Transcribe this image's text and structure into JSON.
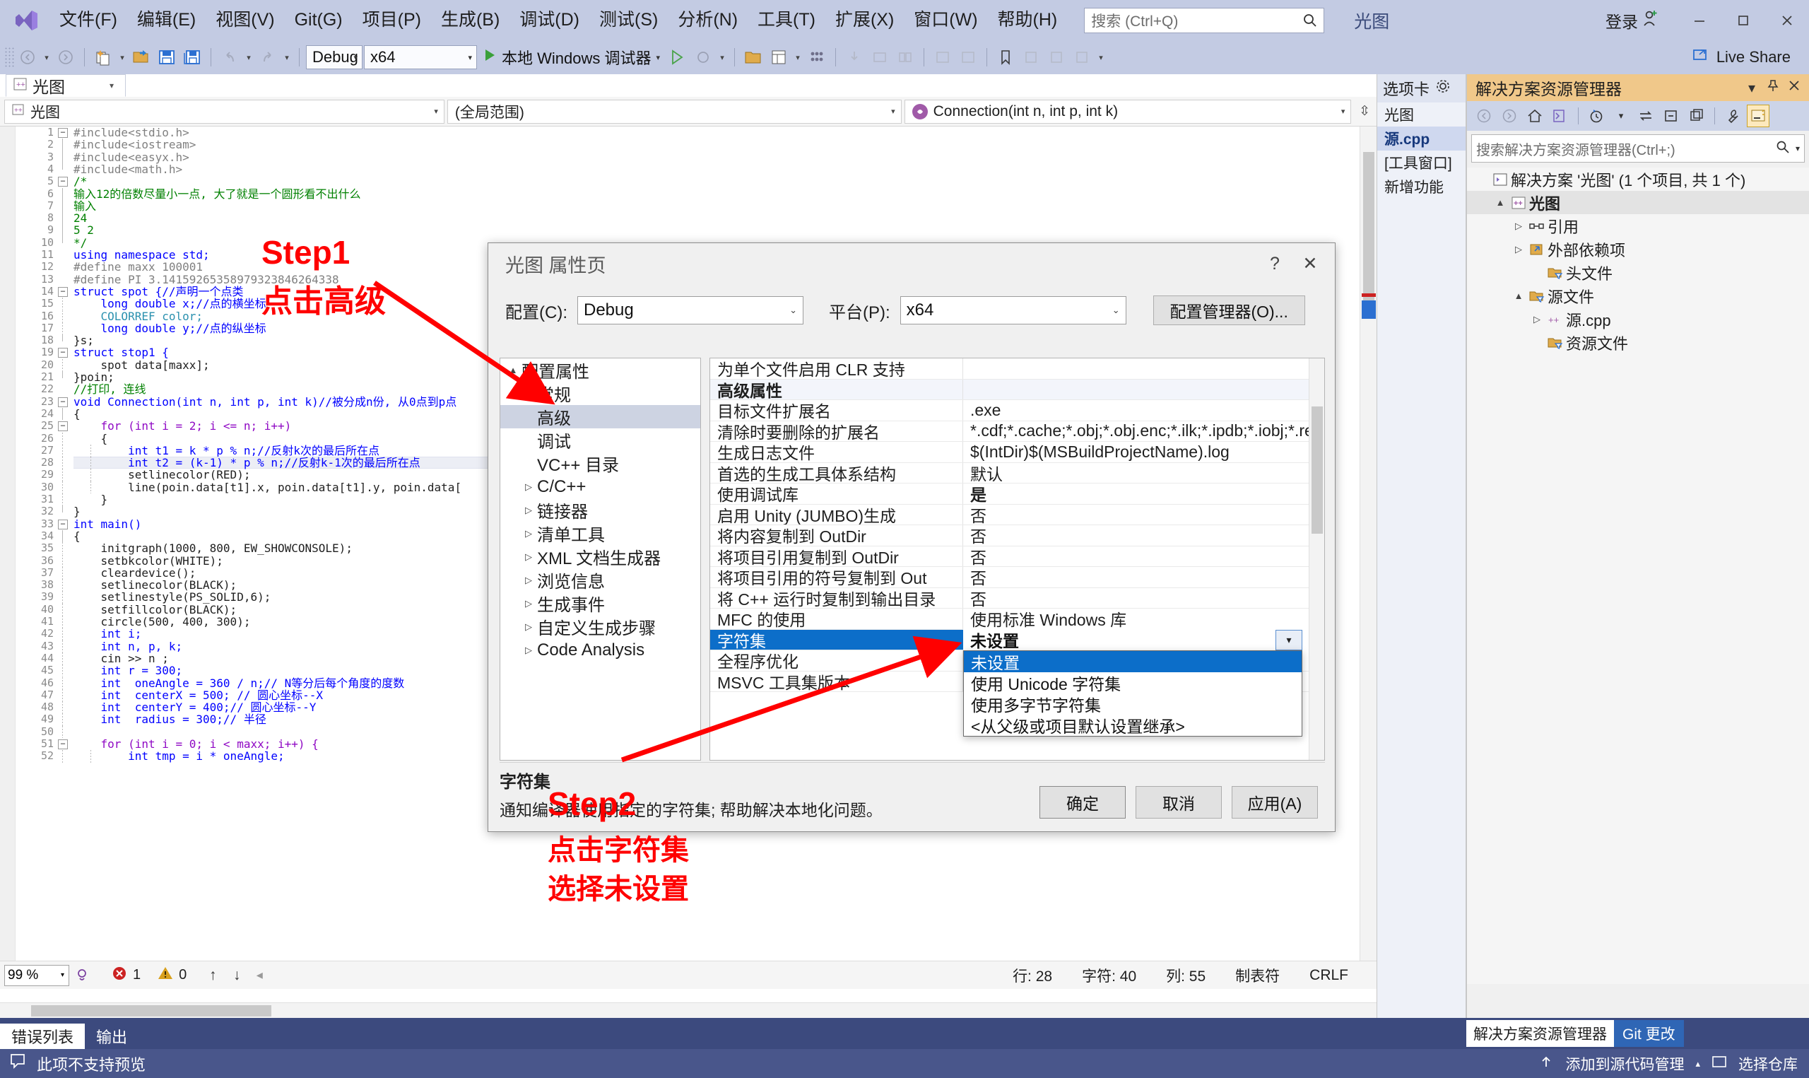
{
  "titlebar": {
    "menus": [
      "文件(F)",
      "编辑(E)",
      "视图(V)",
      "Git(G)",
      "项目(P)",
      "生成(B)",
      "调试(D)",
      "测试(S)",
      "分析(N)",
      "工具(T)",
      "扩展(X)",
      "窗口(W)",
      "帮助(H)"
    ],
    "search_placeholder": "搜索 (Ctrl+Q)",
    "project_title": "光图",
    "signin_label": "登录",
    "minimize": "—",
    "restore": "❐",
    "close": "✕"
  },
  "toolbar": {
    "config_value": "Debug",
    "platform_value": "x64",
    "run_label": "本地 Windows 调试器",
    "live_share_label": "Live Share"
  },
  "editor": {
    "tab_label": "光图",
    "nav_scope_left": "光图",
    "nav_scope_mid": "(全局范围)",
    "nav_member": "Connection(int n, int p, int k)",
    "zoom_level": "99 %",
    "error_count": "1",
    "warning_count": "0",
    "status": {
      "line_label": "行: 28",
      "col_char_label": "字符: 40",
      "col_label": "列: 55",
      "tab_label": "制表符",
      "eol_label": "CRLF"
    },
    "highlight_line": 28,
    "lines": [
      {
        "n": 1,
        "fold": "-",
        "text": "#include<stdio.h>",
        "cls": "pp"
      },
      {
        "n": 2,
        "guide": "solid",
        "text": "#include<iostream>",
        "cls": "pp"
      },
      {
        "n": 3,
        "guide": "solid",
        "text": "#include<easyx.h>",
        "cls": "pp"
      },
      {
        "n": 4,
        "guide": "end",
        "text": "#include<math.h>",
        "cls": "pp"
      },
      {
        "n": 5,
        "fold": "-",
        "text": "/*",
        "cls": "cmt"
      },
      {
        "n": 6,
        "guide": "solid",
        "text": "输入12的倍数尽量小一点, 大了就是一个圆形看不出什么",
        "cls": "cmt"
      },
      {
        "n": 7,
        "guide": "solid",
        "text": "输入",
        "cls": "cmt"
      },
      {
        "n": 8,
        "guide": "solid",
        "text": "24",
        "cls": "cmt"
      },
      {
        "n": 9,
        "guide": "solid",
        "text": "5 2",
        "cls": "cmt"
      },
      {
        "n": 10,
        "guide": "end",
        "text": "*/",
        "cls": "cmt"
      },
      {
        "n": 11,
        "text": "using namespace std;",
        "cls": "kw"
      },
      {
        "n": 12,
        "text": "#define maxx 100001",
        "cls": "pp"
      },
      {
        "n": 13,
        "text": "#define PI 3.14159265358979323846264338",
        "cls": "pp"
      },
      {
        "n": 14,
        "fold": "-",
        "text": "struct spot {//声明一个点类",
        "cls": "kw"
      },
      {
        "n": 15,
        "guide": "dash",
        "text": "    long double x;//点的横坐标",
        "cls": "kw"
      },
      {
        "n": 16,
        "guide": "dash",
        "text": "    COLORREF color;",
        "cls": "typ"
      },
      {
        "n": 17,
        "guide": "dash",
        "text": "    long double y;//点的纵坐标",
        "cls": "kw"
      },
      {
        "n": 18,
        "guide": "end",
        "text": "}s;",
        "cls": "pln"
      },
      {
        "n": 19,
        "fold": "-",
        "text": "struct stop1 {",
        "cls": "kw"
      },
      {
        "n": 20,
        "guide": "dash",
        "text": "    spot data[maxx];",
        "cls": "pln"
      },
      {
        "n": 21,
        "guide": "end",
        "text": "}poin;",
        "cls": "pln"
      },
      {
        "n": 22,
        "text": "//打印, 连线",
        "cls": "cmt"
      },
      {
        "n": 23,
        "fold": "-",
        "text": "void Connection(int n, int p, int k)//被分成n份, 从0点到p点",
        "cls": "kw"
      },
      {
        "n": 24,
        "guide": "solid",
        "text": "{",
        "cls": "pln"
      },
      {
        "n": 25,
        "fold": "-",
        "guide": "dash",
        "text": "    for (int i = 2; i <= n; i++)",
        "cls": "ctl"
      },
      {
        "n": 26,
        "guide": "dash",
        "text": "    {",
        "cls": "pln"
      },
      {
        "n": 27,
        "guide": "dash2",
        "text": "        int t1 = k * p % n;//反射k次的最后所在点",
        "cls": "kw"
      },
      {
        "n": 28,
        "guide": "dash2",
        "text": "        int t2 = (k-1) * p % n;//反射k-1次的最后所在点",
        "cls": "kw"
      },
      {
        "n": 29,
        "guide": "dash2",
        "text": "        setlinecolor(RED);",
        "cls": "pln"
      },
      {
        "n": 30,
        "guide": "dash2",
        "text": "        line(poin.data[t1].x, poin.data[t1].y, poin.data[",
        "cls": "pln"
      },
      {
        "n": 31,
        "guide": "dash",
        "text": "    }",
        "cls": "pln"
      },
      {
        "n": 32,
        "guide": "end",
        "text": "}",
        "cls": "pln"
      },
      {
        "n": 33,
        "fold": "-",
        "text": "int main()",
        "cls": "kw"
      },
      {
        "n": 34,
        "guide": "solid",
        "text": "{",
        "cls": "pln"
      },
      {
        "n": 35,
        "guide": "dash",
        "text": "    initgraph(1000, 800, EW_SHOWCONSOLE);",
        "cls": "pln"
      },
      {
        "n": 36,
        "guide": "dash",
        "text": "    setbkcolor(WHITE);",
        "cls": "pln"
      },
      {
        "n": 37,
        "guide": "dash",
        "text": "    cleardevice();",
        "cls": "pln"
      },
      {
        "n": 38,
        "guide": "dash",
        "text": "    setlinecolor(BLACK);",
        "cls": "pln"
      },
      {
        "n": 39,
        "guide": "dash",
        "text": "    setlinestyle(PS_SOLID,6);",
        "cls": "pln"
      },
      {
        "n": 40,
        "guide": "dash",
        "text": "    setfillcolor(BLACK);",
        "cls": "pln"
      },
      {
        "n": 41,
        "guide": "dash",
        "text": "    circle(500, 400, 300);",
        "cls": "pln"
      },
      {
        "n": 42,
        "guide": "dash",
        "text": "    int i;",
        "cls": "kw"
      },
      {
        "n": 43,
        "guide": "dash",
        "text": "    int n, p, k;",
        "cls": "kw"
      },
      {
        "n": 44,
        "guide": "dash",
        "text": "    cin >> n ;",
        "cls": "pln"
      },
      {
        "n": 45,
        "guide": "dash",
        "text": "    int r = 300;",
        "cls": "kw"
      },
      {
        "n": 46,
        "guide": "dash",
        "text": "    int  oneAngle = 360 / n;// N等分后每个角度的度数",
        "cls": "kw"
      },
      {
        "n": 47,
        "guide": "dash",
        "text": "    int  centerX = 500; // 圆心坐标--X",
        "cls": "kw"
      },
      {
        "n": 48,
        "guide": "dash",
        "text": "    int  centerY = 400;// 圆心坐标--Y",
        "cls": "kw"
      },
      {
        "n": 49,
        "guide": "dash",
        "text": "    int  radius = 300;// 半径",
        "cls": "kw"
      },
      {
        "n": 50,
        "guide": "dash",
        "text": "",
        "cls": "pln"
      },
      {
        "n": 51,
        "fold": "-",
        "guide": "dash",
        "text": "    for (int i = 0; i < maxx; i++) {",
        "cls": "ctl"
      },
      {
        "n": 52,
        "guide": "dash2",
        "text": "        int tmp = i * oneAngle;",
        "cls": "kw"
      }
    ]
  },
  "options_panel": {
    "header": "选项卡",
    "rows": [
      {
        "label": "光图",
        "active": false
      },
      {
        "label": "源.cpp",
        "active": true
      },
      {
        "label": "[工具窗口]",
        "active": false
      },
      {
        "label": "新增功能",
        "active": false
      }
    ]
  },
  "solution_explorer": {
    "title": "解决方案资源管理器",
    "search_placeholder": "搜索解决方案资源管理器(Ctrl+;)",
    "tree": [
      {
        "label": "解决方案 '光图' (1 个项目, 共 1 个)",
        "indent": 0,
        "twisty": "",
        "icon": "solution-icon",
        "bold": false,
        "selected": false
      },
      {
        "label": "光图",
        "indent": 1,
        "twisty": "▲",
        "icon": "cpp-project-icon",
        "bold": true,
        "selected": true
      },
      {
        "label": "引用",
        "indent": 2,
        "twisty": "▷",
        "icon": "references-icon",
        "bold": false,
        "selected": false
      },
      {
        "label": "外部依赖项",
        "indent": 2,
        "twisty": "▷",
        "icon": "external-deps-icon",
        "bold": false,
        "selected": false
      },
      {
        "label": "头文件",
        "indent": 3,
        "twisty": "",
        "icon": "folder-filter-icon",
        "bold": false,
        "selected": false
      },
      {
        "label": "源文件",
        "indent": 2,
        "twisty": "▲",
        "icon": "folder-filter-icon",
        "bold": false,
        "selected": false
      },
      {
        "label": "源.cpp",
        "indent": 3,
        "twisty": "▷",
        "icon": "cpp-file-icon",
        "bold": false,
        "selected": false
      },
      {
        "label": "资源文件",
        "indent": 3,
        "twisty": "",
        "icon": "folder-filter-icon",
        "bold": false,
        "selected": false
      }
    ]
  },
  "dialog": {
    "title": "光图 属性页",
    "help_btn": "?",
    "close_btn": "✕",
    "config_label": "配置(C):",
    "config_value": "Debug",
    "platform_label": "平台(P):",
    "platform_value": "x64",
    "config_manager_btn": "配置管理器(O)...",
    "tree": [
      {
        "label": "配置属性",
        "indent": 0,
        "twisty": "▲",
        "sel": false
      },
      {
        "label": "常规",
        "indent": 1,
        "twisty": "",
        "sel": false
      },
      {
        "label": "高级",
        "indent": 1,
        "twisty": "",
        "sel": true
      },
      {
        "label": "调试",
        "indent": 1,
        "twisty": "",
        "sel": false
      },
      {
        "label": "VC++ 目录",
        "indent": 1,
        "twisty": "",
        "sel": false
      },
      {
        "label": "C/C++",
        "indent": 1,
        "twisty": "▷",
        "sel": false
      },
      {
        "label": "链接器",
        "indent": 1,
        "twisty": "▷",
        "sel": false
      },
      {
        "label": "清单工具",
        "indent": 1,
        "twisty": "▷",
        "sel": false
      },
      {
        "label": "XML 文档生成器",
        "indent": 1,
        "twisty": "▷",
        "sel": false
      },
      {
        "label": "浏览信息",
        "indent": 1,
        "twisty": "▷",
        "sel": false
      },
      {
        "label": "生成事件",
        "indent": 1,
        "twisty": "▷",
        "sel": false
      },
      {
        "label": "自定义生成步骤",
        "indent": 1,
        "twisty": "▷",
        "sel": false
      },
      {
        "label": "Code Analysis",
        "indent": 1,
        "twisty": "▷",
        "sel": false
      }
    ],
    "grid": [
      {
        "name": "为单个文件启用 CLR 支持",
        "value": "",
        "group": false,
        "sel": false,
        "bold": false
      },
      {
        "name": "高级属性",
        "value": "",
        "group": true,
        "sel": false,
        "bold": false
      },
      {
        "name": "目标文件扩展名",
        "value": ".exe",
        "group": false,
        "sel": false,
        "bold": false
      },
      {
        "name": "清除时要删除的扩展名",
        "value": "*.cdf;*.cache;*.obj;*.obj.enc;*.ilk;*.ipdb;*.iobj;*.re",
        "group": false,
        "sel": false,
        "bold": false
      },
      {
        "name": "生成日志文件",
        "value": "$(IntDir)$(MSBuildProjectName).log",
        "group": false,
        "sel": false,
        "bold": false
      },
      {
        "name": "首选的生成工具体系结构",
        "value": "默认",
        "group": false,
        "sel": false,
        "bold": false
      },
      {
        "name": "使用调试库",
        "value": "是",
        "group": false,
        "sel": false,
        "bold": true
      },
      {
        "name": "启用 Unity (JUMBO)生成",
        "value": "否",
        "group": false,
        "sel": false,
        "bold": false
      },
      {
        "name": "将内容复制到 OutDir",
        "value": "否",
        "group": false,
        "sel": false,
        "bold": false
      },
      {
        "name": "将项目引用复制到 OutDir",
        "value": "否",
        "group": false,
        "sel": false,
        "bold": false
      },
      {
        "name": "将项目引用的符号复制到 Out",
        "value": "否",
        "group": false,
        "sel": false,
        "bold": false
      },
      {
        "name": "将 C++ 运行时复制到输出目录",
        "value": "否",
        "group": false,
        "sel": false,
        "bold": false
      },
      {
        "name": "MFC 的使用",
        "value": "使用标准 Windows 库",
        "group": false,
        "sel": false,
        "bold": false
      },
      {
        "name": "字符集",
        "value": "未设置",
        "group": false,
        "sel": true,
        "bold": true
      },
      {
        "name": "全程序优化",
        "value": "",
        "group": false,
        "sel": false,
        "bold": false
      },
      {
        "name": "MSVC 工具集版本",
        "value": "",
        "group": false,
        "sel": false,
        "bold": false
      }
    ],
    "dropdown": {
      "items": [
        "未设置",
        "使用 Unicode 字符集",
        "使用多字节字符集",
        "<从父级或项目默认设置继承>"
      ],
      "selected_index": 0
    },
    "desc_title": "字符集",
    "desc_text": "通知编译器使用指定的字符集; 帮助解决本地化问题。",
    "buttons": {
      "ok": "确定",
      "cancel": "取消",
      "apply": "应用(A)"
    }
  },
  "bottom_panel": {
    "tabs": [
      {
        "label": "错误列表",
        "active": true
      },
      {
        "label": "输出",
        "active": false
      }
    ],
    "message": "此项不支持预览",
    "solution_explorer_tab": "解决方案资源管理器",
    "git_changes_tab": "Git 更改",
    "add_to_source_control": "添加到源代码管理",
    "select_repo": "选择仓库"
  },
  "annotations": {
    "step1": "Step1",
    "step1_sub": "点击高级",
    "step2": "Step2",
    "step2_line1": "点击字符集",
    "step2_line2": "选择未设置"
  },
  "colors": {
    "accent_blue": "#0c6ec9",
    "chrome_blue": "#c3cbe3",
    "annotation_red": "#ff0000",
    "panel_gold": "#f0c88a",
    "bottom_navy": "#3c4a7e"
  }
}
